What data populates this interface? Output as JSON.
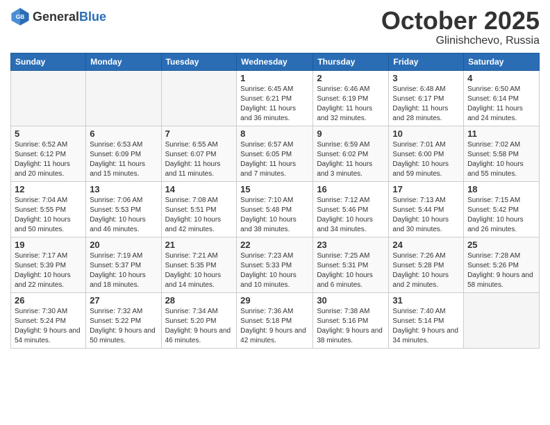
{
  "header": {
    "logo_general": "General",
    "logo_blue": "Blue",
    "title": "October 2025",
    "location": "Glinishchevo, Russia"
  },
  "columns": [
    "Sunday",
    "Monday",
    "Tuesday",
    "Wednesday",
    "Thursday",
    "Friday",
    "Saturday"
  ],
  "weeks": [
    [
      {
        "day": "",
        "empty": true
      },
      {
        "day": "",
        "empty": true
      },
      {
        "day": "",
        "empty": true
      },
      {
        "day": "1",
        "sunrise": "6:45 AM",
        "sunset": "6:21 PM",
        "daylight": "11 hours and 36 minutes."
      },
      {
        "day": "2",
        "sunrise": "6:46 AM",
        "sunset": "6:19 PM",
        "daylight": "11 hours and 32 minutes."
      },
      {
        "day": "3",
        "sunrise": "6:48 AM",
        "sunset": "6:17 PM",
        "daylight": "11 hours and 28 minutes."
      },
      {
        "day": "4",
        "sunrise": "6:50 AM",
        "sunset": "6:14 PM",
        "daylight": "11 hours and 24 minutes."
      }
    ],
    [
      {
        "day": "5",
        "sunrise": "6:52 AM",
        "sunset": "6:12 PM",
        "daylight": "11 hours and 20 minutes."
      },
      {
        "day": "6",
        "sunrise": "6:53 AM",
        "sunset": "6:09 PM",
        "daylight": "11 hours and 15 minutes."
      },
      {
        "day": "7",
        "sunrise": "6:55 AM",
        "sunset": "6:07 PM",
        "daylight": "11 hours and 11 minutes."
      },
      {
        "day": "8",
        "sunrise": "6:57 AM",
        "sunset": "6:05 PM",
        "daylight": "11 hours and 7 minutes."
      },
      {
        "day": "9",
        "sunrise": "6:59 AM",
        "sunset": "6:02 PM",
        "daylight": "11 hours and 3 minutes."
      },
      {
        "day": "10",
        "sunrise": "7:01 AM",
        "sunset": "6:00 PM",
        "daylight": "10 hours and 59 minutes."
      },
      {
        "day": "11",
        "sunrise": "7:02 AM",
        "sunset": "5:58 PM",
        "daylight": "10 hours and 55 minutes."
      }
    ],
    [
      {
        "day": "12",
        "sunrise": "7:04 AM",
        "sunset": "5:55 PM",
        "daylight": "10 hours and 50 minutes."
      },
      {
        "day": "13",
        "sunrise": "7:06 AM",
        "sunset": "5:53 PM",
        "daylight": "10 hours and 46 minutes."
      },
      {
        "day": "14",
        "sunrise": "7:08 AM",
        "sunset": "5:51 PM",
        "daylight": "10 hours and 42 minutes."
      },
      {
        "day": "15",
        "sunrise": "7:10 AM",
        "sunset": "5:48 PM",
        "daylight": "10 hours and 38 minutes."
      },
      {
        "day": "16",
        "sunrise": "7:12 AM",
        "sunset": "5:46 PM",
        "daylight": "10 hours and 34 minutes."
      },
      {
        "day": "17",
        "sunrise": "7:13 AM",
        "sunset": "5:44 PM",
        "daylight": "10 hours and 30 minutes."
      },
      {
        "day": "18",
        "sunrise": "7:15 AM",
        "sunset": "5:42 PM",
        "daylight": "10 hours and 26 minutes."
      }
    ],
    [
      {
        "day": "19",
        "sunrise": "7:17 AM",
        "sunset": "5:39 PM",
        "daylight": "10 hours and 22 minutes."
      },
      {
        "day": "20",
        "sunrise": "7:19 AM",
        "sunset": "5:37 PM",
        "daylight": "10 hours and 18 minutes."
      },
      {
        "day": "21",
        "sunrise": "7:21 AM",
        "sunset": "5:35 PM",
        "daylight": "10 hours and 14 minutes."
      },
      {
        "day": "22",
        "sunrise": "7:23 AM",
        "sunset": "5:33 PM",
        "daylight": "10 hours and 10 minutes."
      },
      {
        "day": "23",
        "sunrise": "7:25 AM",
        "sunset": "5:31 PM",
        "daylight": "10 hours and 6 minutes."
      },
      {
        "day": "24",
        "sunrise": "7:26 AM",
        "sunset": "5:28 PM",
        "daylight": "10 hours and 2 minutes."
      },
      {
        "day": "25",
        "sunrise": "7:28 AM",
        "sunset": "5:26 PM",
        "daylight": "9 hours and 58 minutes."
      }
    ],
    [
      {
        "day": "26",
        "sunrise": "7:30 AM",
        "sunset": "5:24 PM",
        "daylight": "9 hours and 54 minutes."
      },
      {
        "day": "27",
        "sunrise": "7:32 AM",
        "sunset": "5:22 PM",
        "daylight": "9 hours and 50 minutes."
      },
      {
        "day": "28",
        "sunrise": "7:34 AM",
        "sunset": "5:20 PM",
        "daylight": "9 hours and 46 minutes."
      },
      {
        "day": "29",
        "sunrise": "7:36 AM",
        "sunset": "5:18 PM",
        "daylight": "9 hours and 42 minutes."
      },
      {
        "day": "30",
        "sunrise": "7:38 AM",
        "sunset": "5:16 PM",
        "daylight": "9 hours and 38 minutes."
      },
      {
        "day": "31",
        "sunrise": "7:40 AM",
        "sunset": "5:14 PM",
        "daylight": "9 hours and 34 minutes."
      },
      {
        "day": "",
        "empty": true
      }
    ]
  ]
}
